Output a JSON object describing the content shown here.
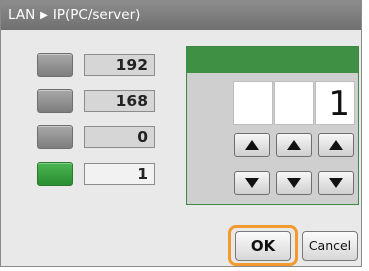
{
  "title": {
    "section": "LAN",
    "separator": "▶",
    "page": "IP(PC/server)"
  },
  "octets": [
    {
      "value": "192",
      "selected": false
    },
    {
      "value": "168",
      "selected": false
    },
    {
      "value": "0",
      "selected": false
    },
    {
      "value": "1",
      "selected": true
    }
  ],
  "digit_editor": {
    "digits": [
      "",
      "",
      "1"
    ],
    "up_icon": "triangle-up-icon",
    "down_icon": "triangle-down-icon"
  },
  "buttons": {
    "ok_label": "OK",
    "cancel_label": "Cancel"
  },
  "colors": {
    "title_bar": "#7f7f7f",
    "selected_green": "#3a9b40",
    "focus_orange": "#f19a2e"
  }
}
